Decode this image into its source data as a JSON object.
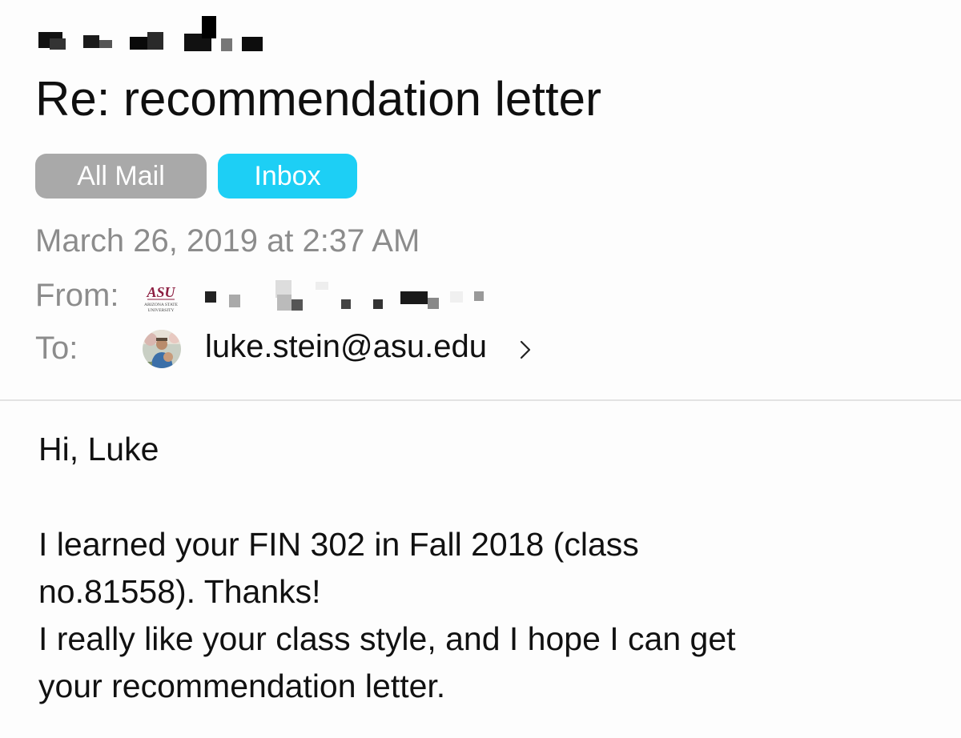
{
  "email": {
    "subject": "Re: recommendation letter",
    "tags": [
      {
        "label": "All Mail",
        "color": "#a9a9a9"
      },
      {
        "label": "Inbox",
        "color": "#1dcff5"
      }
    ],
    "date": "March 26, 2019 at 2:37 AM",
    "from": {
      "label": "From:",
      "logo_text": "ASU",
      "logo_subtext": "ARIZONA STATE UNIVERSITY",
      "logo_color": "#8c1d40"
    },
    "to": {
      "label": "To:",
      "address": "luke.stein@asu.edu",
      "chevron": "›"
    },
    "body": {
      "greeting": "Hi, Luke",
      "lines": [
        "I learned your FIN 302 in Fall 2018 (class",
        "no.81558).  Thanks!",
        "I really like your class style, and I hope I can get",
        "your recommendation letter."
      ]
    }
  }
}
